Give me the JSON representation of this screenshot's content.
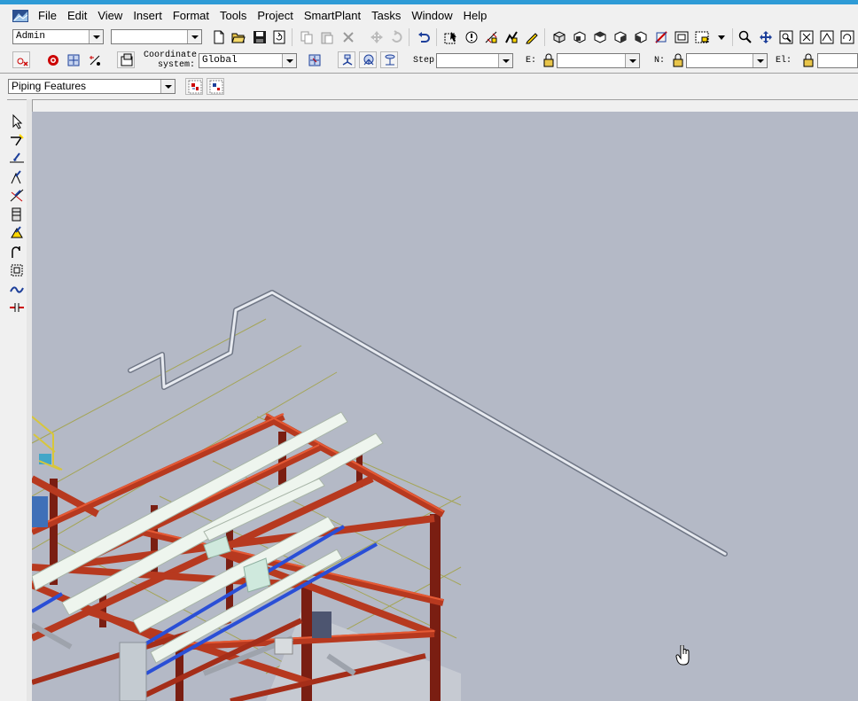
{
  "menu": {
    "items": [
      "File",
      "Edit",
      "View",
      "Insert",
      "Format",
      "Tools",
      "Project",
      "SmartPlant",
      "Tasks",
      "Window",
      "Help"
    ]
  },
  "toolbar1": {
    "permission_group": "Admin",
    "second_combo": ""
  },
  "toolbar2": {
    "coordinate_label_line1": "Coordinate",
    "coordinate_label_line2": "system:",
    "coordinate_system": "Global",
    "step_label": "Step:",
    "step_value": "",
    "east_label": "E:",
    "east_value": "",
    "north_label": "N:",
    "north_value": "",
    "elevation_label": "El:",
    "elevation_value": ""
  },
  "toolbar3": {
    "task_selector": "Piping Features"
  },
  "colors": {
    "viewport_background": "#b4b9c6",
    "steel_member": "#b7391f",
    "cable_tray": "#eef5ee",
    "blue_pipe": "#2a4fd6",
    "grid_line": "#9a9a2a"
  },
  "icons": {
    "left_toolbar": [
      "select-arrow-icon",
      "route-pipe-icon",
      "insert-component-icon",
      "insert-instrument-icon",
      "insert-specialty-icon",
      "insert-tap-icon",
      "insert-split-icon",
      "insert-turn-icon",
      "insert-jumper-icon",
      "insert-feature-icon",
      "insert-gap-icon"
    ]
  }
}
